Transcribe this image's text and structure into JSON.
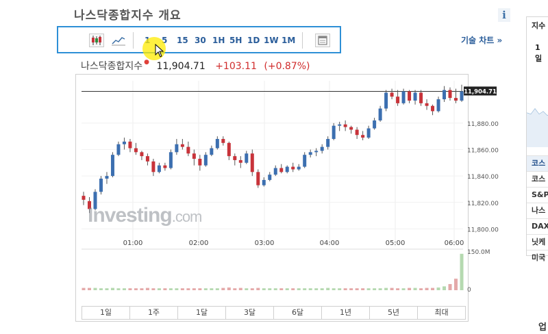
{
  "page": {
    "title": "나스닥종합지수 개요",
    "info_label": "i"
  },
  "toolbar": {
    "intervals": [
      "1",
      "5",
      "15",
      "30",
      "1H",
      "5H",
      "1D",
      "1W",
      "1M"
    ],
    "technical_link": "기술 차트 »"
  },
  "quote": {
    "name": "나스닥종합지수",
    "price": "11,904.71",
    "change": "+103.11",
    "change_pct": "(+0.87%)"
  },
  "watermark": {
    "brand": "Investing",
    "suffix": ".com"
  },
  "range_tabs": [
    "1일",
    "1주",
    "1달",
    "3달",
    "6달",
    "1년",
    "5년",
    "최대"
  ],
  "right_panel": {
    "header": "지수",
    "date_lines": [
      "1",
      "일"
    ],
    "items": [
      "코스",
      "코스",
      "S&P",
      "나스",
      "DAX",
      "닛케",
      "미국"
    ]
  },
  "bottom_right": "업",
  "colors": {
    "up": "#3c6fb0",
    "down": "#c8333a",
    "accent": "#2d8fd6",
    "vol_up": "#b5d9b0",
    "vol_down": "#e4a9a9"
  },
  "chart_data": {
    "type": "candlestick",
    "x_tick_labels": [
      "01:00",
      "02:00",
      "03:00",
      "04:00",
      "05:00",
      "06:00"
    ],
    "y_tick_labels": [
      "11,800.00",
      "11,820.00",
      "11,840.00",
      "11,860.00",
      "11,880.00"
    ],
    "price_label": "11,904.71",
    "ylim": [
      11794,
      11912
    ],
    "volume_tick_labels": [
      "150.0M",
      "0"
    ],
    "candles_ohlc": [
      [
        11825,
        11828,
        11818,
        11822
      ],
      [
        11821,
        11824,
        11812,
        11815
      ],
      [
        11815,
        11830,
        11814,
        11828
      ],
      [
        11828,
        11840,
        11826,
        11838
      ],
      [
        11838,
        11843,
        11834,
        11840
      ],
      [
        11840,
        11858,
        11839,
        11856
      ],
      [
        11856,
        11866,
        11855,
        11864
      ],
      [
        11864,
        11869,
        11860,
        11866
      ],
      [
        11866,
        11868,
        11858,
        11861
      ],
      [
        11861,
        11865,
        11856,
        11858
      ],
      [
        11858,
        11859,
        11852,
        11855
      ],
      [
        11855,
        11857,
        11848,
        11851
      ],
      [
        11851,
        11853,
        11840,
        11843
      ],
      [
        11843,
        11850,
        11842,
        11848
      ],
      [
        11848,
        11850,
        11844,
        11846
      ],
      [
        11846,
        11860,
        11845,
        11858
      ],
      [
        11858,
        11868,
        11856,
        11864
      ],
      [
        11864,
        11868,
        11860,
        11862
      ],
      [
        11862,
        11866,
        11855,
        11857
      ],
      [
        11857,
        11860,
        11848,
        11853
      ],
      [
        11853,
        11856,
        11844,
        11848
      ],
      [
        11848,
        11858,
        11847,
        11856
      ],
      [
        11856,
        11863,
        11855,
        11861
      ],
      [
        11861,
        11870,
        11860,
        11868
      ],
      [
        11868,
        11870,
        11863,
        11865
      ],
      [
        11865,
        11866,
        11852,
        11855
      ],
      [
        11855,
        11857,
        11848,
        11852
      ],
      [
        11852,
        11855,
        11846,
        11850
      ],
      [
        11850,
        11859,
        11849,
        11857
      ],
      [
        11857,
        11860,
        11840,
        11843
      ],
      [
        11843,
        11845,
        11831,
        11833
      ],
      [
        11833,
        11839,
        11832,
        11837
      ],
      [
        11837,
        11843,
        11836,
        11841
      ],
      [
        11841,
        11848,
        11840,
        11846
      ],
      [
        11846,
        11849,
        11842,
        11843
      ],
      [
        11843,
        11848,
        11842,
        11847
      ],
      [
        11847,
        11850,
        11843,
        11845
      ],
      [
        11845,
        11849,
        11844,
        11847
      ],
      [
        11847,
        11858,
        11846,
        11856
      ],
      [
        11856,
        11860,
        11854,
        11858
      ],
      [
        11858,
        11861,
        11855,
        11859
      ],
      [
        11859,
        11864,
        11857,
        11862
      ],
      [
        11862,
        11870,
        11860,
        11868
      ],
      [
        11868,
        11880,
        11867,
        11878
      ],
      [
        11878,
        11881,
        11874,
        11879
      ],
      [
        11879,
        11882,
        11874,
        11877
      ],
      [
        11877,
        11878,
        11872,
        11875
      ],
      [
        11875,
        11877,
        11868,
        11871
      ],
      [
        11871,
        11874,
        11867,
        11869
      ],
      [
        11869,
        11878,
        11868,
        11876
      ],
      [
        11876,
        11884,
        11875,
        11882
      ],
      [
        11882,
        11893,
        11881,
        11891
      ],
      [
        11891,
        11905,
        11889,
        11903
      ],
      [
        11903,
        11906,
        11898,
        11900
      ],
      [
        11900,
        11905,
        11893,
        11895
      ],
      [
        11895,
        11906,
        11894,
        11904
      ],
      [
        11904,
        11905,
        11895,
        11897
      ],
      [
        11897,
        11905,
        11894,
        11903
      ],
      [
        11903,
        11905,
        11893,
        11895
      ],
      [
        11895,
        11898,
        11890,
        11893
      ],
      [
        11893,
        11894,
        11886,
        11889
      ],
      [
        11889,
        11900,
        11888,
        11898
      ],
      [
        11898,
        11908,
        11896,
        11905
      ],
      [
        11905,
        11907,
        11897,
        11899
      ],
      [
        11899,
        11906,
        11895,
        11897
      ],
      [
        11897,
        11909,
        11896,
        11904
      ]
    ],
    "volume_rel": [
      0.06,
      0.06,
      0.06,
      0.05,
      0.05,
      0.06,
      0.05,
      0.05,
      0.05,
      0.05,
      0.05,
      0.06,
      0.05,
      0.05,
      0.05,
      0.05,
      0.05,
      0.05,
      0.05,
      0.05,
      0.05,
      0.05,
      0.05,
      0.05,
      0.06,
      0.07,
      0.05,
      0.06,
      0.05,
      0.05,
      0.06,
      0.05,
      0.05,
      0.05,
      0.05,
      0.05,
      0.05,
      0.05,
      0.05,
      0.05,
      0.05,
      0.05,
      0.06,
      0.05,
      0.05,
      0.05,
      0.05,
      0.05,
      0.05,
      0.05,
      0.05,
      0.05,
      0.06,
      0.06,
      0.05,
      0.05,
      0.06,
      0.06,
      0.05,
      0.06,
      0.06,
      0.07,
      0.1,
      0.16,
      0.3,
      0.95
    ]
  }
}
